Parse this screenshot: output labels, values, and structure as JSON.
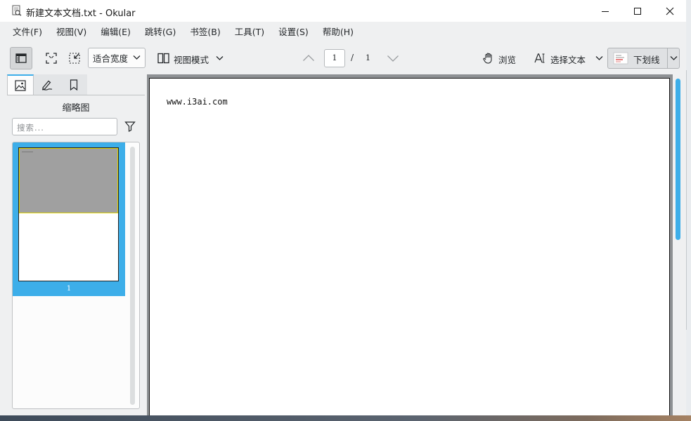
{
  "window": {
    "title": "新建文本文档.txt  - Okular",
    "controls": [
      "minimize-icon",
      "maximize-icon",
      "close-icon"
    ]
  },
  "menubar": {
    "items": [
      "文件(F)",
      "视图(V)",
      "编辑(E)",
      "跳转(G)",
      "书签(B)",
      "工具(T)",
      "设置(S)",
      "帮助(H)"
    ]
  },
  "toolbar": {
    "zoom_value": "适合宽度",
    "view_mode_label": "视图模式",
    "page_current": "1",
    "page_separator": "/",
    "page_total": "1",
    "browse_label": "浏览",
    "select_text_label": "选择文本",
    "annotation_label": "下划线"
  },
  "sidebar": {
    "tabs": [
      "thumbnails-icon",
      "annotations-icon",
      "bookmarks-icon"
    ],
    "panel_title": "缩略图",
    "search_placeholder": "搜索...",
    "thumbnails": [
      {
        "page_number": "1",
        "selected": true
      }
    ]
  },
  "document": {
    "text": "www.i3ai.com"
  },
  "colors": {
    "accent": "#3daee9",
    "window_bg": "#eff0f1",
    "doc_bg": "#8e9194",
    "highlight_border": "#e0d300"
  }
}
